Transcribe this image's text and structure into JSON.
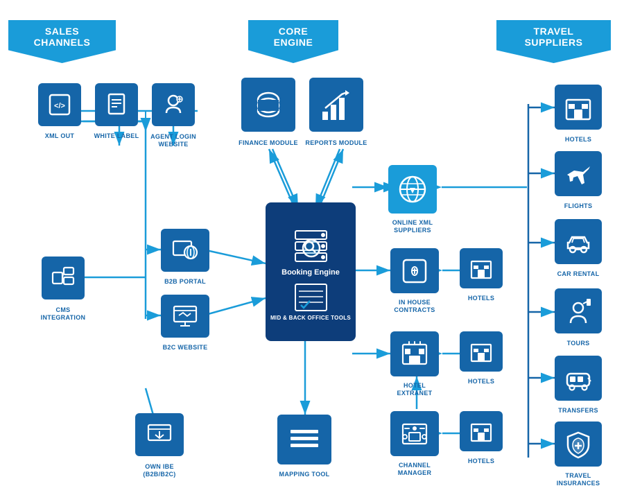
{
  "banners": {
    "sales_channels": "SALES CHANNELS",
    "core_engine": "CORE ENGINE",
    "travel_suppliers": "TRAVEL SUPPLIERS"
  },
  "sales_channels": {
    "xml_out": {
      "label": "XML OUT"
    },
    "white_label": {
      "label": "WHITE LABEL"
    },
    "agent_login": {
      "label": "AGENT LOGIN\nWEBSITE"
    },
    "b2b_portal": {
      "label": "B2B PORTAL"
    },
    "b2c_website": {
      "label": "B2C WEBSITE"
    },
    "cms_integration": {
      "label": "CMS\nINTEGRATION"
    },
    "own_ibe": {
      "label": "OWN IBE\n(B2B/B2C)"
    }
  },
  "core_engine": {
    "finance_module": {
      "label": "FINANCE MODULE"
    },
    "reports_module": {
      "label": "REPORTS MODULE"
    },
    "booking_engine": {
      "label": "Booking Engine"
    },
    "mid_back": {
      "label": "MID & BACK OFFICE TOOLS"
    },
    "mapping_tool": {
      "label": "MAPPING TOOL"
    }
  },
  "middle": {
    "online_xml": {
      "label": "ONLINE XML\nSUPPLIERS"
    },
    "in_house": {
      "label": "IN HOUSE\nCONTRACTS"
    },
    "hotels1": {
      "label": "HOTELS"
    },
    "hotel_extranet": {
      "label": "HOTEL\nEXTRANET"
    },
    "hotels2": {
      "label": "HOTELS"
    },
    "channel_manager": {
      "label": "CHANNEL\nMANAGER"
    },
    "hotels3": {
      "label": "HOTELS"
    }
  },
  "travel_suppliers": {
    "hotels": {
      "label": "HOTELS"
    },
    "flights": {
      "label": "FLIGHTS"
    },
    "car_rental": {
      "label": "CAR RENTAL"
    },
    "tours": {
      "label": "TOURS"
    },
    "transfers": {
      "label": "TRANSFERS"
    },
    "travel_insurances": {
      "label": "TRAVEL\nINSURANCES"
    }
  }
}
